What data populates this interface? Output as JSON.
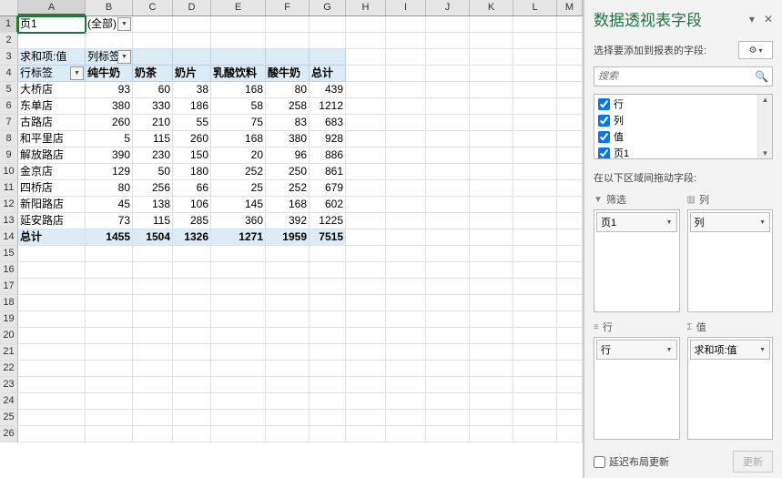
{
  "columns": [
    "A",
    "B",
    "C",
    "D",
    "E",
    "F",
    "G",
    "H",
    "I",
    "J",
    "K",
    "L",
    "M"
  ],
  "col_widths": [
    "cw-A",
    "cw-B",
    "cw-C",
    "cw-D",
    "cw-E",
    "cw-F",
    "cw-G",
    "cw-H",
    "cw-I",
    "cw-J",
    "cw-K",
    "cw-L",
    "cw-M"
  ],
  "selected_col": "A",
  "selected_row": 1,
  "page_filter": {
    "label": "页1",
    "value": "(全部)"
  },
  "pivot_header": {
    "value_label": "求和项:值",
    "col_label": "列标签"
  },
  "row_axis_label": "行标签",
  "col_labels": [
    "纯牛奶",
    "奶茶",
    "奶片",
    "乳酸饮料",
    "酸牛奶",
    "总计"
  ],
  "rows": [
    {
      "name": "大桥店",
      "vals": [
        93,
        60,
        38,
        168,
        80,
        439
      ]
    },
    {
      "name": "东单店",
      "vals": [
        380,
        330,
        186,
        58,
        258,
        1212
      ]
    },
    {
      "name": "古路店",
      "vals": [
        260,
        210,
        55,
        75,
        83,
        683
      ]
    },
    {
      "name": "和平里店",
      "vals": [
        5,
        115,
        260,
        168,
        380,
        928
      ]
    },
    {
      "name": "解放路店",
      "vals": [
        390,
        230,
        150,
        20,
        96,
        886
      ]
    },
    {
      "name": "金京店",
      "vals": [
        129,
        50,
        180,
        252,
        250,
        861
      ]
    },
    {
      "name": "四桥店",
      "vals": [
        80,
        256,
        66,
        25,
        252,
        679
      ]
    },
    {
      "name": "新阳路店",
      "vals": [
        45,
        138,
        106,
        145,
        168,
        602
      ]
    },
    {
      "name": "延安路店",
      "vals": [
        73,
        115,
        285,
        360,
        392,
        1225
      ]
    }
  ],
  "grand_total": {
    "label": "总计",
    "vals": [
      1455,
      1504,
      1326,
      1271,
      1959,
      7515
    ]
  },
  "total_grid_rows": 26,
  "pane": {
    "title": "数据透视表字段",
    "choose_label": "选择要添加到报表的字段:",
    "search_placeholder": "搜索",
    "fields": [
      {
        "label": "行",
        "checked": true
      },
      {
        "label": "列",
        "checked": true
      },
      {
        "label": "值",
        "checked": true
      },
      {
        "label": "页1",
        "checked": true
      }
    ],
    "drag_label": "在以下区域间拖动字段:",
    "areas": {
      "filter": {
        "title": "筛选",
        "items": [
          "页1"
        ]
      },
      "columns": {
        "title": "列",
        "items": [
          "列"
        ]
      },
      "rows_area": {
        "title": "行",
        "items": [
          "行"
        ]
      },
      "values": {
        "title": "值",
        "items": [
          "求和项:值"
        ]
      }
    },
    "defer_label": "延迟布局更新",
    "update_button": "更新"
  },
  "chart_data": {
    "type": "table",
    "title": "求和项:值",
    "row_field": "行",
    "col_field": "列",
    "columns": [
      "纯牛奶",
      "奶茶",
      "奶片",
      "乳酸饮料",
      "酸牛奶"
    ],
    "rows": [
      "大桥店",
      "东单店",
      "古路店",
      "和平里店",
      "解放路店",
      "金京店",
      "四桥店",
      "新阳路店",
      "延安路店"
    ],
    "values": [
      [
        93,
        60,
        38,
        168,
        80
      ],
      [
        380,
        330,
        186,
        58,
        258
      ],
      [
        260,
        210,
        55,
        75,
        83
      ],
      [
        5,
        115,
        260,
        168,
        380
      ],
      [
        390,
        230,
        150,
        20,
        96
      ],
      [
        129,
        50,
        180,
        252,
        250
      ],
      [
        80,
        256,
        66,
        25,
        252
      ],
      [
        45,
        138,
        106,
        145,
        168
      ],
      [
        73,
        115,
        285,
        360,
        392
      ]
    ],
    "row_totals": [
      439,
      1212,
      683,
      928,
      886,
      861,
      679,
      602,
      1225
    ],
    "col_totals": [
      1455,
      1504,
      1326,
      1271,
      1959
    ],
    "grand_total": 7515
  }
}
